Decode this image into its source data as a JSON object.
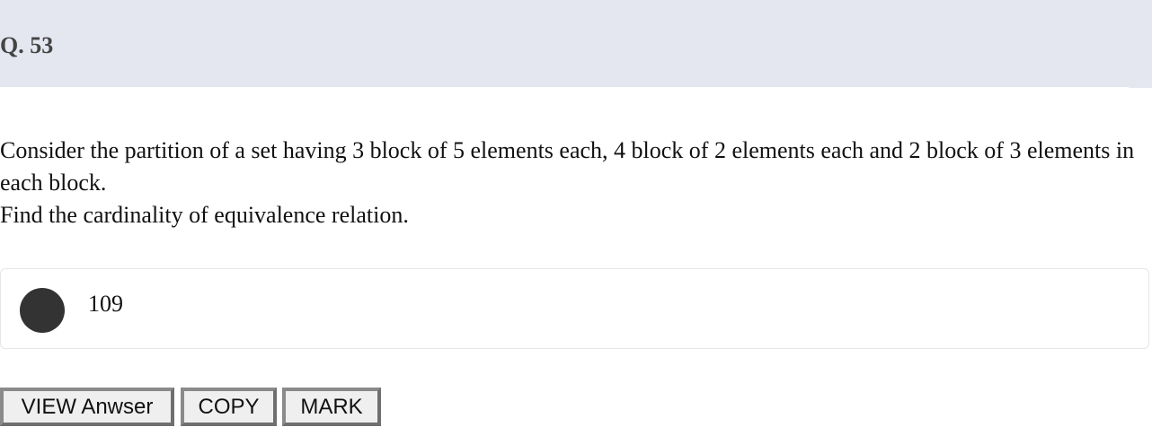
{
  "question": {
    "number_label": "Q. 53",
    "lines": [
      "Consider the partition of a set having 3 block of 5 elements each, 4 block of 2 elements each and 2 block of 3 elements in each block.",
      "Find the cardinality of equivalence relation."
    ]
  },
  "options": [
    {
      "label": "109",
      "selected": true
    }
  ],
  "actions": {
    "view_answer_label": "VIEW Anwser",
    "copy_label": "COPY",
    "mark_label": "MARK"
  },
  "colors": {
    "header_background": "#e4e7f0",
    "radio_fill": "#333333",
    "button_background": "#efefef",
    "button_border": "#8a8a8a"
  }
}
